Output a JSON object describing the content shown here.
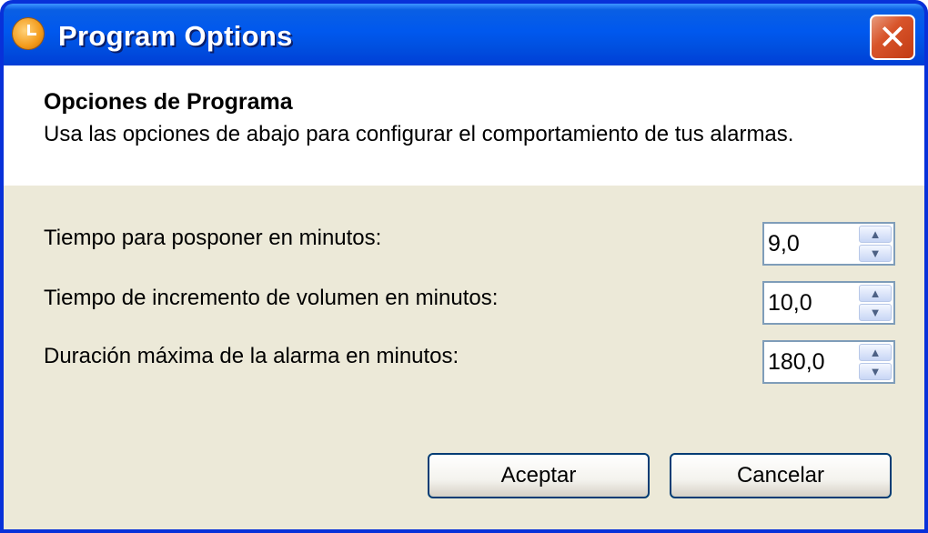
{
  "window": {
    "title": "Program Options",
    "icon": "alarm-clock-icon",
    "close_glyph": "✕"
  },
  "header": {
    "title": "Opciones de Programa",
    "description": "Usa las opciones de abajo para configurar el comportamiento de tus alarmas."
  },
  "fields": [
    {
      "label": "Tiempo para posponer en minutos:",
      "value": "9,0"
    },
    {
      "label": "Tiempo de incremento de volumen en minutos:",
      "value": "10,0"
    },
    {
      "label": "Duración máxima de la alarma en minutos:",
      "value": "180,0"
    }
  ],
  "spinner_glyphs": {
    "up": "▲",
    "down": "▼"
  },
  "buttons": {
    "accept": "Aceptar",
    "cancel": "Cancelar"
  },
  "colors": {
    "titlebar": "#0058ee",
    "dialog_background": "#ece9d8",
    "close_button": "#d8542a"
  }
}
